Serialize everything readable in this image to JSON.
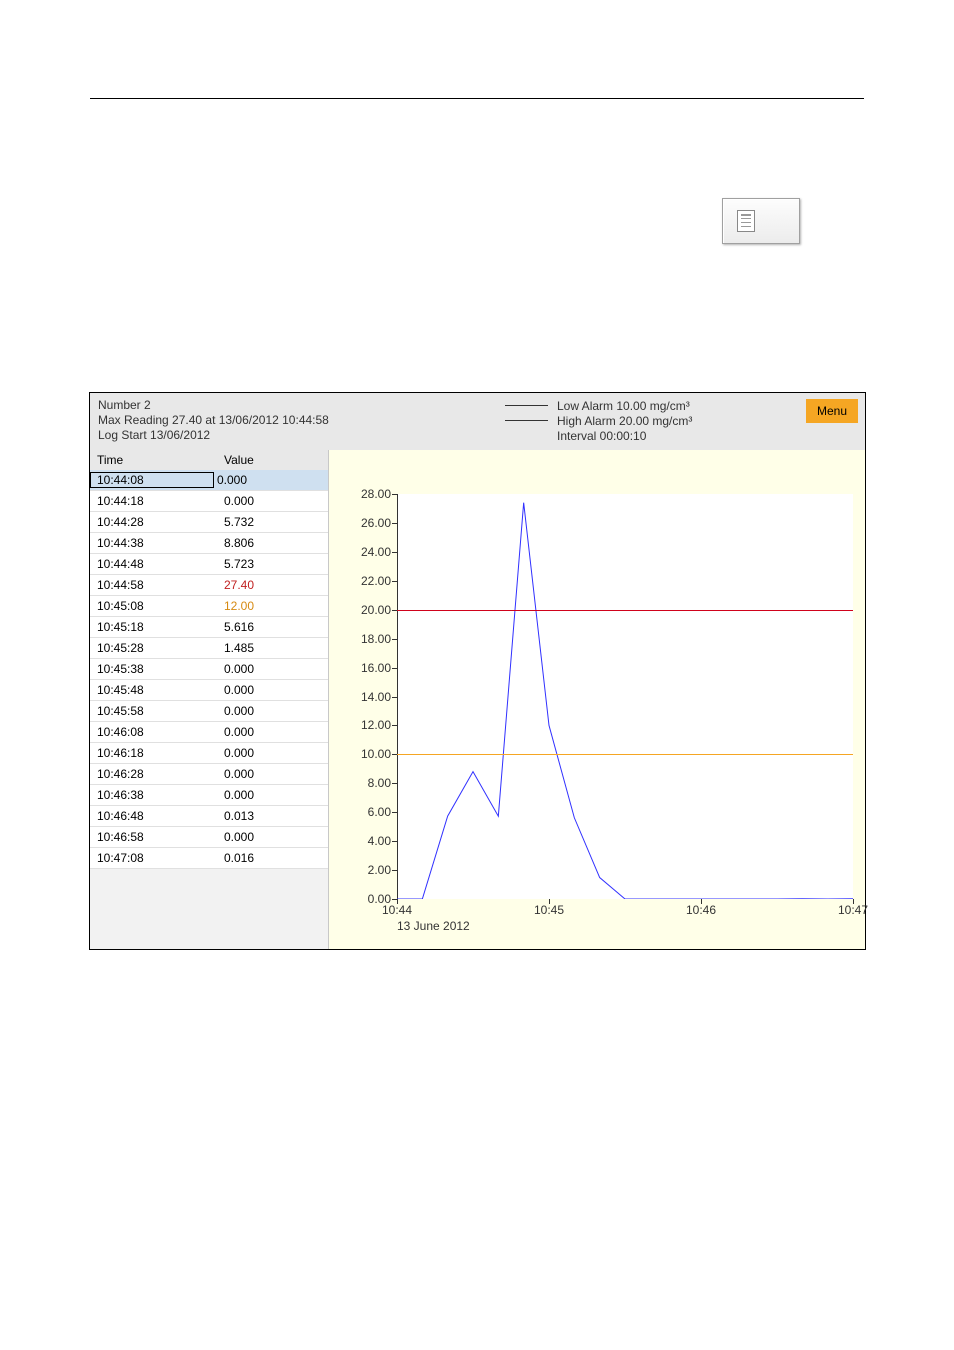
{
  "header": {
    "line1": "Number 2",
    "line2": "Max Reading 27.40 at 13/06/2012 10:44:58",
    "line3": "Log Start 13/06/2012"
  },
  "legend": {
    "low_label": "Low Alarm 10.00 mg/cm³",
    "high_label": "High Alarm 20.00 mg/cm³",
    "interval_label": "Interval 00:00:10"
  },
  "menu_label": "Menu",
  "table": {
    "col_time": "Time",
    "col_value": "Value",
    "rows": [
      {
        "time": "10:44:08",
        "value": "0.000",
        "cls": ""
      },
      {
        "time": "10:44:18",
        "value": "0.000",
        "cls": ""
      },
      {
        "time": "10:44:28",
        "value": "5.732",
        "cls": ""
      },
      {
        "time": "10:44:38",
        "value": "8.806",
        "cls": ""
      },
      {
        "time": "10:44:48",
        "value": "5.723",
        "cls": ""
      },
      {
        "time": "10:44:58",
        "value": "27.40",
        "cls": "v-high"
      },
      {
        "time": "10:45:08",
        "value": "12.00",
        "cls": "v-low"
      },
      {
        "time": "10:45:18",
        "value": "5.616",
        "cls": ""
      },
      {
        "time": "10:45:28",
        "value": "1.485",
        "cls": ""
      },
      {
        "time": "10:45:38",
        "value": "0.000",
        "cls": ""
      },
      {
        "time": "10:45:48",
        "value": "0.000",
        "cls": ""
      },
      {
        "time": "10:45:58",
        "value": "0.000",
        "cls": ""
      },
      {
        "time": "10:46:08",
        "value": "0.000",
        "cls": ""
      },
      {
        "time": "10:46:18",
        "value": "0.000",
        "cls": ""
      },
      {
        "time": "10:46:28",
        "value": "0.000",
        "cls": ""
      },
      {
        "time": "10:46:38",
        "value": "0.000",
        "cls": ""
      },
      {
        "time": "10:46:48",
        "value": "0.013",
        "cls": ""
      },
      {
        "time": "10:46:58",
        "value": "0.000",
        "cls": ""
      },
      {
        "time": "10:47:08",
        "value": "0.016",
        "cls": ""
      }
    ],
    "selected_index": 0
  },
  "chart_data": {
    "type": "line",
    "x_time_seconds": [
      0,
      10,
      20,
      30,
      40,
      50,
      60,
      70,
      80,
      90,
      100,
      110,
      120,
      130,
      140,
      150,
      160,
      170,
      180
    ],
    "values": [
      0.0,
      0.0,
      5.732,
      8.806,
      5.723,
      27.4,
      12.0,
      5.616,
      1.485,
      0.0,
      0.0,
      0.0,
      0.0,
      0.0,
      0.0,
      0.0,
      0.013,
      0.0,
      0.016
    ],
    "ylim": [
      0,
      28
    ],
    "yticks": [
      0,
      2,
      4,
      6,
      8,
      10,
      12,
      14,
      16,
      18,
      20,
      22,
      24,
      26,
      28
    ],
    "xticks_seconds": [
      0,
      60,
      120,
      180
    ],
    "xtick_labels": [
      "10:44",
      "10:45",
      "10:46",
      "10:47"
    ],
    "x_date": "13 June 2012",
    "low_alarm": 10.0,
    "high_alarm": 20.0,
    "title": "",
    "xlabel": "",
    "ylabel": ""
  }
}
